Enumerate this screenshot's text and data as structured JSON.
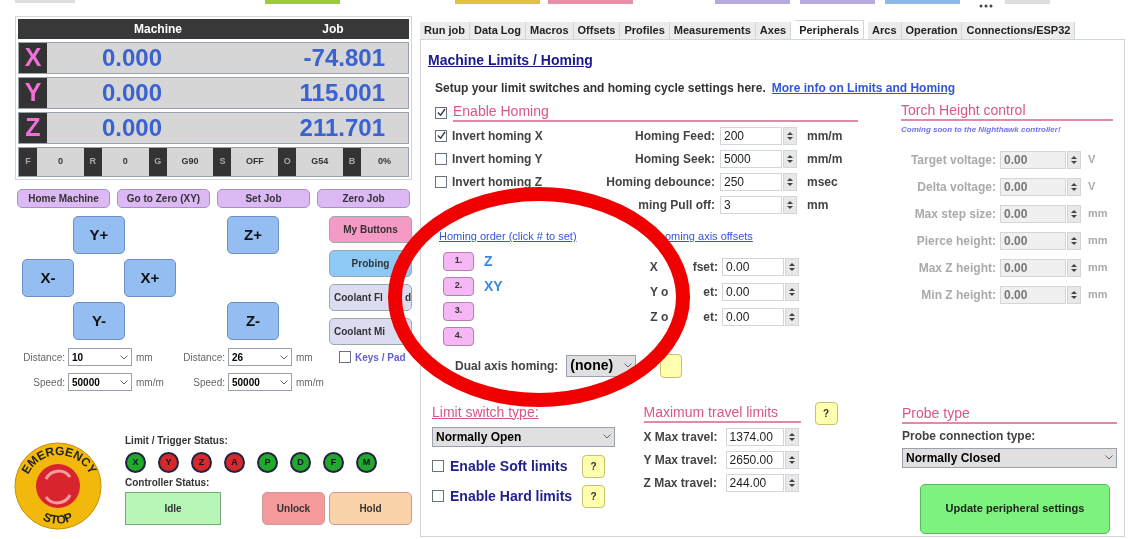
{
  "dro": {
    "headers": [
      "Machine",
      "Job"
    ],
    "axes": [
      {
        "axis": "X",
        "machine": "0.000",
        "job": "-74.801"
      },
      {
        "axis": "Y",
        "machine": "0.000",
        "job": "115.001"
      },
      {
        "axis": "Z",
        "machine": "0.000",
        "job": "211.701"
      }
    ],
    "status": [
      {
        "key": "F",
        "value": "0"
      },
      {
        "key": "R",
        "value": "0"
      },
      {
        "key": "G",
        "value": "G90"
      },
      {
        "key": "S",
        "value": "OFF"
      },
      {
        "key": "O",
        "value": "G54"
      },
      {
        "key": "B",
        "value": "0%"
      }
    ]
  },
  "action_buttons": [
    "Home Machine",
    "Go to Zero (XY)",
    "Set Job",
    "Zero Job"
  ],
  "jog_buttons": [
    {
      "label": "Y+"
    },
    {
      "label": "Z+"
    },
    {
      "label": "X-"
    },
    {
      "label": "X+"
    },
    {
      "label": "Y-"
    },
    {
      "label": "Z-"
    }
  ],
  "side_buttons": [
    {
      "label_parts": [
        "My Buttons"
      ],
      "color": "#f59ac4"
    },
    {
      "label_parts": [
        "Probing"
      ],
      "color": "#8ec8f5"
    },
    {
      "label_parts": [
        "Coolant Fl",
        "d"
      ],
      "color": "#dcdcf0"
    },
    {
      "label_parts": [
        "Coolant Mi"
      ],
      "color": "#dcdcf0"
    }
  ],
  "jog_settings": [
    {
      "distance_label": "Distance:",
      "distance": "10",
      "distance_unit": "mm",
      "speed_label": "Speed:",
      "speed": "50000",
      "speed_unit": "mm/m"
    },
    {
      "distance_label": "Distance:",
      "distance": "26",
      "distance_unit": "mm",
      "speed_label": "Speed:",
      "speed": "50000",
      "speed_unit": "mm/m"
    }
  ],
  "keys_pad": {
    "label": "Keys / Pad",
    "checked": false
  },
  "emergency_stop": {
    "top": "EMERGENCY",
    "bottom": "STOP"
  },
  "limit_status": {
    "label": "Limit / Trigger Status:",
    "pins": [
      {
        "label": "X",
        "color": "#22a82a"
      },
      {
        "label": "Y",
        "color": "#d42a2a"
      },
      {
        "label": "Z",
        "color": "#d42a2a"
      },
      {
        "label": "A",
        "color": "#d42a2a"
      },
      {
        "label": "P",
        "color": "#22a82a"
      },
      {
        "label": "D",
        "color": "#22a82a"
      },
      {
        "label": "F",
        "color": "#22a82a"
      },
      {
        "label": "M",
        "color": "#22a82a"
      }
    ]
  },
  "controller_status": {
    "label": "Controller Status:",
    "state": "Idle"
  },
  "control_buttons": [
    {
      "label": "Unlock",
      "color": "#f59a9a"
    },
    {
      "label": "Hold",
      "color": "#fbd3a8"
    }
  ],
  "tabs": [
    {
      "label": "Run job",
      "selected": false
    },
    {
      "label": "Data Log",
      "selected": false
    },
    {
      "label": "Macros",
      "selected": false
    },
    {
      "label": "Offsets",
      "selected": false
    },
    {
      "label": "Profiles",
      "selected": false
    },
    {
      "label": "Measurements",
      "selected": false
    },
    {
      "label": "Axes",
      "selected": false
    },
    {
      "label": "Peripherals",
      "selected": true
    },
    {
      "label": "Arcs",
      "selected": false
    },
    {
      "label": "Operation",
      "selected": false
    },
    {
      "label": "Connections/ESP32",
      "selected": false
    }
  ],
  "section": {
    "title": "Machine Limits / Homing",
    "intro": "Setup your limit switches and homing cycle settings here.",
    "link": "More info on Limits and Homing"
  },
  "homing": {
    "enable": {
      "label": "Enable Homing",
      "checked": true
    },
    "invert": [
      {
        "label": "Invert homing X",
        "checked": true
      },
      {
        "label": "Invert homing Y",
        "checked": false
      },
      {
        "label": "Invert homing Z",
        "checked": false
      }
    ],
    "settings": [
      {
        "label": "Homing Feed:",
        "value": "200",
        "unit": "mm/m"
      },
      {
        "label": "Homing Seek:",
        "value": "5000",
        "unit": "mm/m"
      },
      {
        "label": "Homing debounce:",
        "value": "250",
        "unit": "msec"
      },
      {
        "label": "ming Pull off:",
        "value": "3",
        "unit": "mm"
      }
    ],
    "order_link": "Homing order (click # to set)",
    "order": [
      {
        "number": "1.",
        "axes": "Z"
      },
      {
        "number": "2.",
        "axes": "XY"
      },
      {
        "number": "3."
      },
      {
        "number": "4."
      }
    ],
    "offsets_link": "oming axis offsets",
    "offsets": [
      {
        "label_parts": [
          "X",
          "fset:"
        ],
        "value": "0.00"
      },
      {
        "label_parts": [
          "Y o",
          "et:"
        ],
        "value": "0.00"
      },
      {
        "label_parts": [
          "Z o",
          "et:"
        ],
        "value": "0.00"
      }
    ],
    "dual": {
      "label": "Dual axis homing:",
      "value": "(none)"
    }
  },
  "torch": {
    "title": "Torch Height control",
    "note": "Coming soon to the Nighthawk controller!",
    "disabled": true,
    "rows": [
      {
        "label": "Target voltage:",
        "value": "0.00",
        "unit": "V"
      },
      {
        "label": "Delta voltage:",
        "value": "0.00",
        "unit": "V"
      },
      {
        "label": "Max step size:",
        "value": "0.00",
        "unit": "mm"
      },
      {
        "label": "Pierce height:",
        "value": "0.00",
        "unit": "mm"
      },
      {
        "label": "Max Z height:",
        "value": "0.00",
        "unit": "mm"
      },
      {
        "label": "Min Z height:",
        "value": "0.00",
        "unit": "mm"
      }
    ]
  },
  "limit_switch": {
    "title": "Limit switch type:",
    "value": "Normally Open",
    "options": [
      {
        "label": "Enable Soft limits",
        "checked": false,
        "help": "?"
      },
      {
        "label": "Enable Hard limits",
        "checked": false,
        "help": "?"
      }
    ]
  },
  "travel": {
    "title": "Maximum travel limits",
    "help": "?",
    "rows": [
      {
        "label": "X Max travel:",
        "value": "1374.00"
      },
      {
        "label": "Y Max travel:",
        "value": "2650.00"
      },
      {
        "label": "Z Max travel:",
        "value": "244.00"
      }
    ]
  },
  "probe": {
    "title": "Probe type",
    "label": "Probe connection type:",
    "value": "Normally Closed"
  },
  "update_button": "Update peripheral settings"
}
